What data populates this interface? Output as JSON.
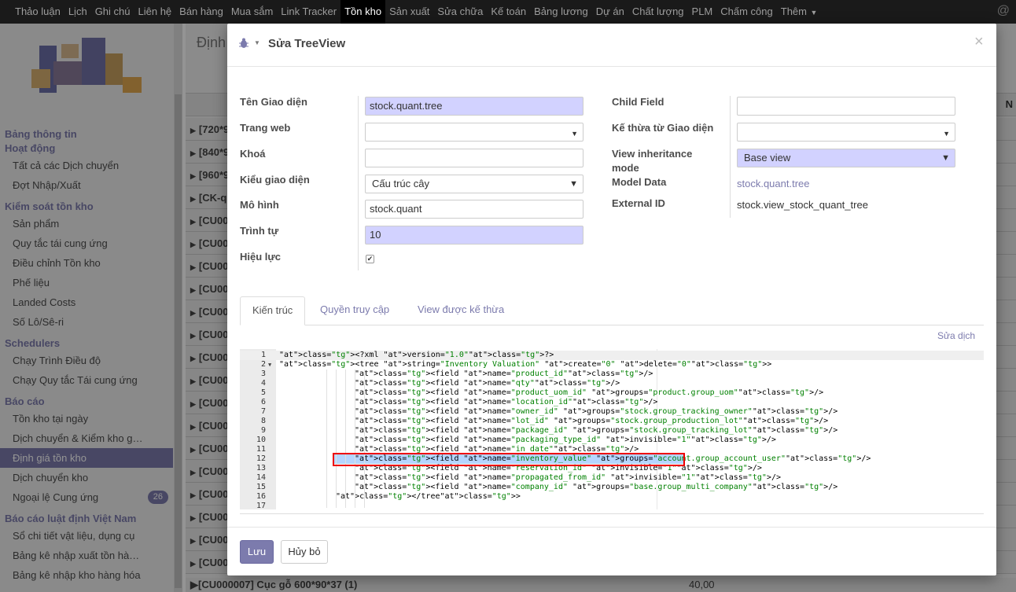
{
  "topnav": {
    "items": [
      "Thảo luận",
      "Lịch",
      "Ghi chú",
      "Liên hệ",
      "Bán hàng",
      "Mua sắm",
      "Link Tracker",
      "Tồn kho",
      "Sản xuất",
      "Sửa chữa",
      "Kế toán",
      "Bảng lương",
      "Dự án",
      "Chất lượng",
      "PLM",
      "Chấm công",
      "Thêm"
    ],
    "active": "Tồn kho"
  },
  "sidebar": {
    "sections": [
      {
        "title": "Bảng thông tin",
        "items": []
      },
      {
        "title": "Hoạt động",
        "items": [
          "Tất cả các Dịch chuyển",
          "Đợt Nhập/Xuất"
        ]
      },
      {
        "title": "Kiểm soát tồn kho",
        "items": [
          "Sản phẩm",
          "Quy tắc tái cung ứng",
          "Điều chỉnh Tồn kho",
          "Phế liệu",
          "Landed Costs",
          "Số Lô/Sê-ri"
        ]
      },
      {
        "title": "Schedulers",
        "items": [
          "Chạy Trình Điều độ",
          "Chạy Quy tắc Tái cung ứng"
        ]
      },
      {
        "title": "Báo cáo",
        "items": [
          "Tồn kho tại ngày",
          "Dịch chuyển & Kiểm kho g…",
          "Định giá tồn kho",
          "Dịch chuyển kho",
          "Ngoại lệ Cung ứng"
        ]
      },
      {
        "title": "Báo cáo luật định Việt Nam",
        "items": [
          "Sổ chi tiết vật liệu, dụng cụ",
          "Bảng kê nhập xuất tồn hà…",
          "Bảng kê nhập kho hàng hóa"
        ]
      }
    ],
    "active_item": "Định giá tồn kho",
    "badge": "26"
  },
  "background": {
    "title": "Định",
    "header_right": "N",
    "rows": [
      "[720*9",
      "[840*9",
      "[960*9",
      "[CK-qu",
      "[CU00",
      "[CU00",
      "[CU00",
      "[CU00",
      "[CU00",
      "[CU00",
      "[CU00",
      "[CU00",
      "[CU00",
      "[CU00",
      "[CU00",
      "[CU00",
      "[CU00",
      "[CU00",
      "[CU00",
      "[CU00"
    ],
    "last_row": "[CU000007] Cục gỗ 600*90*37 (1)",
    "last_value": "40,00"
  },
  "modal": {
    "title": "Sửa TreeView",
    "left_fields": [
      {
        "label": "Tên Giao diện",
        "value": "stock.quant.tree"
      },
      {
        "label": "Trang web",
        "value": ""
      },
      {
        "label": "Khoá",
        "value": ""
      },
      {
        "label": "Kiểu giao diện",
        "value": "Cấu trúc cây"
      },
      {
        "label": "Mô hình",
        "value": "stock.quant"
      },
      {
        "label": "Trình tự",
        "value": "10"
      },
      {
        "label": "Hiệu lực",
        "value": "✔"
      }
    ],
    "right_fields": [
      {
        "label": "Child Field",
        "value": ""
      },
      {
        "label": "Kế thừa từ Giao diện",
        "value": ""
      },
      {
        "label": "View inheritance mode",
        "value": "Base view"
      },
      {
        "label": "Model Data",
        "value": "stock.quant.tree"
      },
      {
        "label": "External ID",
        "value": "stock.view_stock_quant_tree"
      }
    ],
    "tabs": [
      "Kiến trúc",
      "Quyền truy cập",
      "View được kế thừa"
    ],
    "active_tab": "Kiến trúc",
    "translate_link": "Sửa dịch",
    "code_lines": [
      "<?xml version=\"1.0\"?>",
      "<tree string=\"Inventory Valuation\" create=\"0\" delete=\"0\">",
      "<field name=\"product_id\"/>",
      "<field name=\"qty\"/>",
      "<field name=\"product_uom_id\" groups=\"product.group_uom\"/>",
      "<field name=\"location_id\"/>",
      "<field name=\"owner_id\" groups=\"stock.group_tracking_owner\"/>",
      "<field name=\"lot_id\" groups=\"stock.group_production_lot\"/>",
      "<field name=\"package_id\" groups=\"stock.group_tracking_lot\"/>",
      "<field name=\"packaging_type_id\" invisible=\"1\"/>",
      "<field name=\"in_date\"/>",
      "<field name=\"inventory_value\" groups=\"account.group_account_user\"/>",
      "<field name=\"reservation_id\" invisible=\"1\"/>",
      "<field name=\"propagated_from_id\" invisible=\"1\"/>",
      "<field name=\"company_id\" groups=\"base.group_multi_company\"/>",
      "</tree>",
      ""
    ],
    "highlighted_line": 12,
    "save_label": "Lưu",
    "cancel_label": "Hủy bỏ"
  }
}
